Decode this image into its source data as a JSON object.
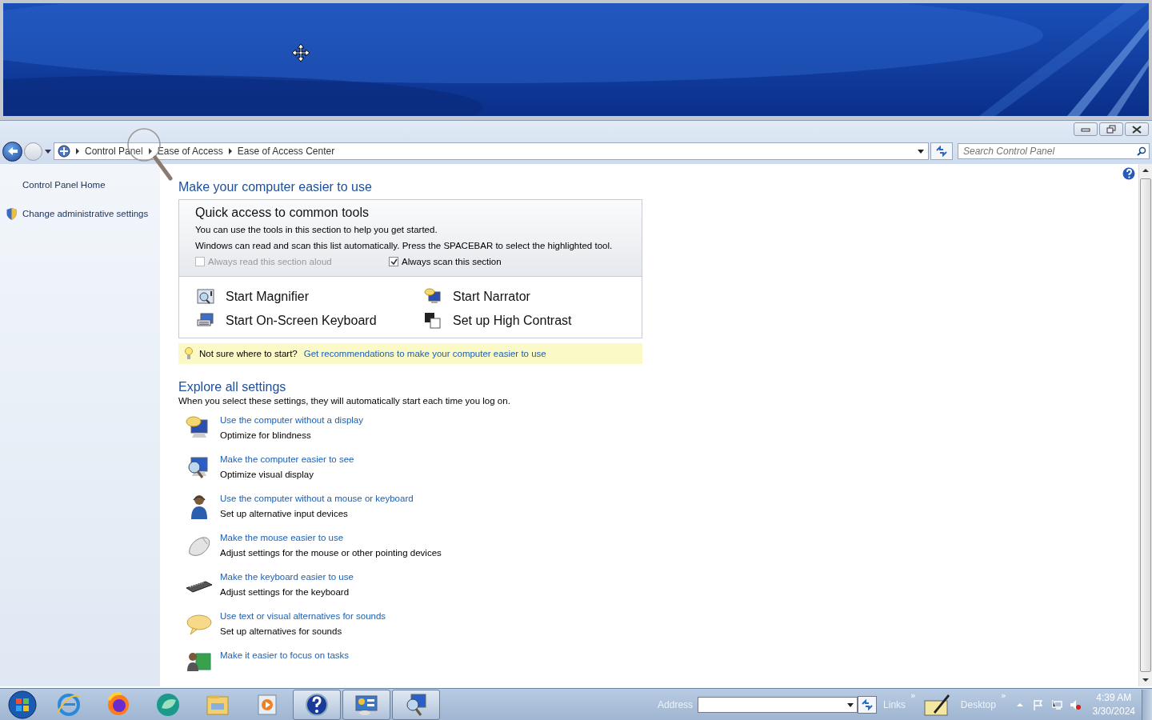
{
  "address_bar": {
    "breadcrumbs": [
      "Control Panel",
      "Ease of Access",
      "Ease of Access Center"
    ],
    "search_placeholder": "Search Control Panel"
  },
  "sidebar": {
    "items": [
      {
        "label": "Control Panel Home",
        "kind": "link"
      },
      {
        "label": "Change administrative settings",
        "kind": "shield"
      }
    ]
  },
  "main": {
    "title": "Make your computer easier to use",
    "quick_access": {
      "title": "Quick access to common tools",
      "lines": [
        "You can use the tools in this section to help you get started.",
        "Windows can read and scan this list automatically.  Press the SPACEBAR to select the highlighted tool."
      ],
      "options": [
        {
          "label": "Always read this section aloud",
          "checked": false,
          "disabled": true
        },
        {
          "label": "Always scan this section",
          "checked": true,
          "disabled": false
        }
      ],
      "tools": [
        {
          "label": "Start Magnifier"
        },
        {
          "label": "Start Narrator"
        },
        {
          "label": "Start On-Screen Keyboard"
        },
        {
          "label": "Set up High Contrast"
        }
      ]
    },
    "tip": {
      "text": "Not sure where to start?",
      "link": "Get recommendations to make your computer easier to use"
    },
    "explore": {
      "title": "Explore all settings",
      "description": "When you select these settings, they will automatically start each time you log on.",
      "items": [
        {
          "link": "Use the computer without a display",
          "description": "Optimize for blindness"
        },
        {
          "link": "Make the computer easier to see",
          "description": "Optimize visual display"
        },
        {
          "link": "Use the computer without a mouse or keyboard",
          "description": "Set up alternative input devices"
        },
        {
          "link": "Make the mouse easier to use",
          "description": "Adjust settings for the mouse or other pointing devices"
        },
        {
          "link": "Make the keyboard easier to use",
          "description": "Adjust settings for the keyboard"
        },
        {
          "link": "Use text or visual alternatives for sounds",
          "description": "Set up alternatives for sounds"
        },
        {
          "link": "Make it easier to focus on tasks"
        }
      ]
    }
  },
  "taskbar": {
    "pinned": [
      {
        "open": false
      },
      {
        "open": false
      },
      {
        "open": false
      },
      {
        "open": false
      },
      {
        "open": false
      },
      {
        "open": true
      },
      {
        "open": true
      },
      {
        "open": true
      }
    ],
    "address_label": "Address",
    "links_label": "Links",
    "links_chevron": "»",
    "desktop_label": "Desktop",
    "desktop_chevron": "»",
    "time": "4:39 AM",
    "date": "3/30/2024"
  }
}
